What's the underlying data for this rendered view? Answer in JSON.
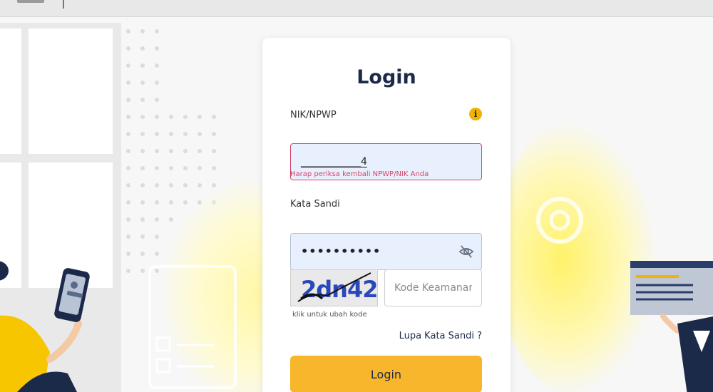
{
  "login": {
    "title": "Login",
    "nik_label": "NIK/NPWP",
    "nik_value": "____________4",
    "error_message": "Harap periksa kembali NPWP/NIK Anda",
    "password_label": "Kata Sandi",
    "password_value": "••••••••••",
    "captcha_text": "2dn42",
    "captcha_caption": "klik untuk ubah kode",
    "security_placeholder": "Kode Keamanan",
    "forgot_password": "Lupa Kata Sandi ?",
    "submit_label": "Login"
  },
  "icons": {
    "info": "info-icon",
    "password_toggle": "eye-slash-icon"
  },
  "colors": {
    "accent": "#f7b62b",
    "error": "#d64566",
    "title": "#1c2a4a",
    "input_bg": "#e8f0fe",
    "info": "#f0b400"
  }
}
